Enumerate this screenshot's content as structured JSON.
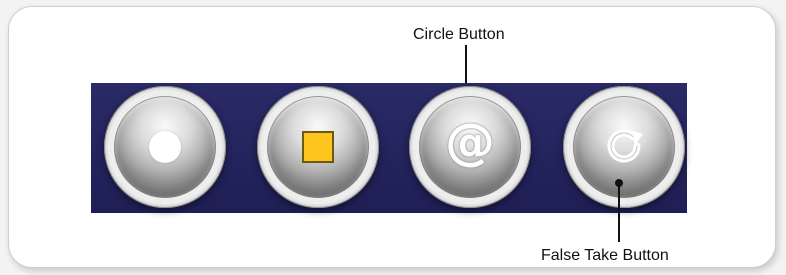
{
  "callouts": {
    "circle_button": "Circle Button",
    "false_take_button": "False Take Button"
  },
  "buttons": [
    {
      "name": "record",
      "icon": "record-icon"
    },
    {
      "name": "stop",
      "icon": "stop-icon",
      "color": "#ffc51f"
    },
    {
      "name": "circle",
      "icon": "at-icon",
      "glyph": "@"
    },
    {
      "name": "false-take",
      "icon": "refresh-icon"
    }
  ],
  "colors": {
    "panel_background": "#1f1f56",
    "stop_icon": "#ffc51f",
    "frame_background": "#ffffff"
  }
}
